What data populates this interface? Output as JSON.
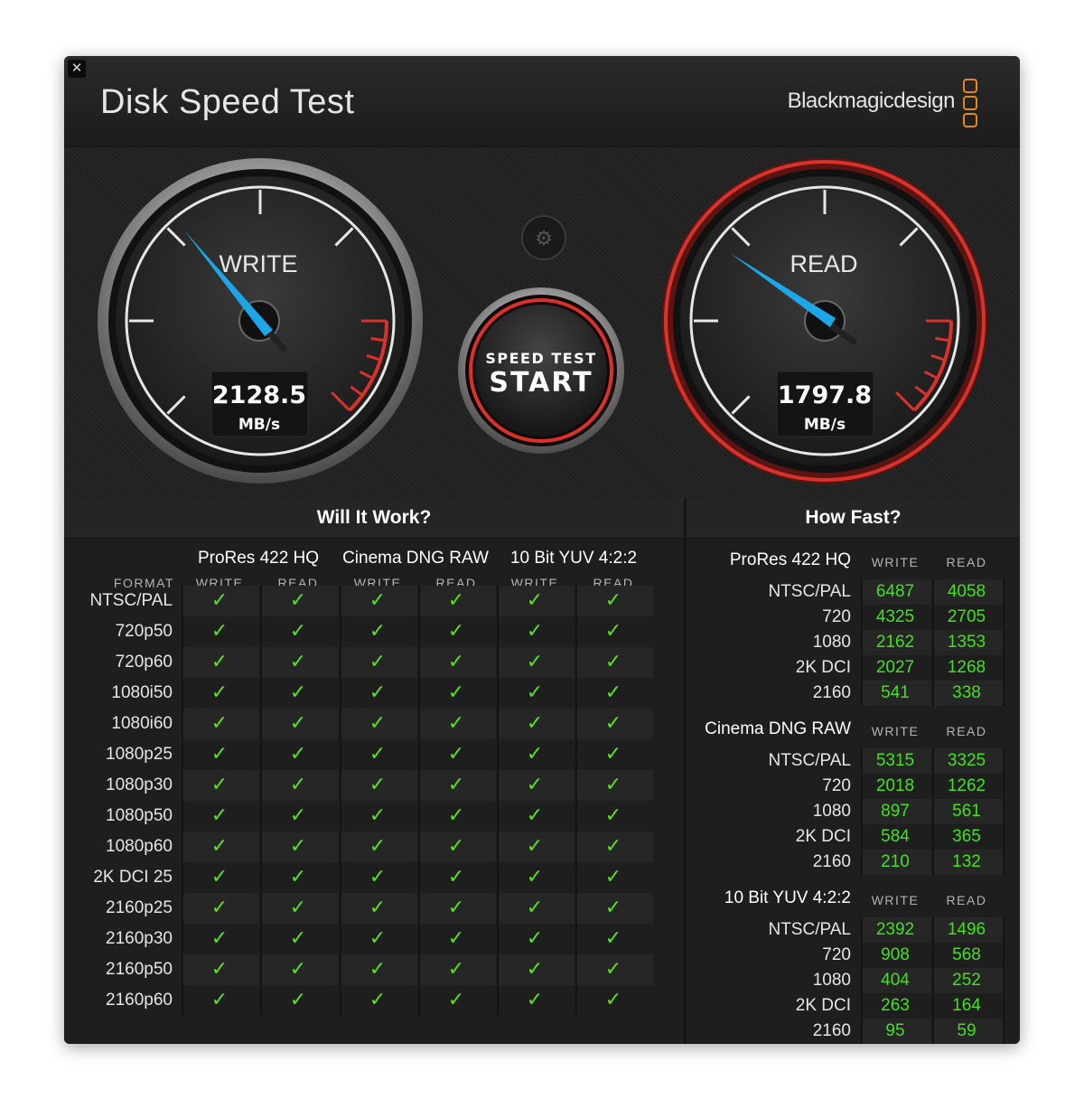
{
  "window": {
    "close_label": "✕",
    "title": "Disk Speed Test",
    "brand": "Blackmagicdesign"
  },
  "gauges": {
    "write": {
      "label": "WRITE",
      "value": "2128.5",
      "unit": "MB/s"
    },
    "read": {
      "label": "READ",
      "value": "1797.8",
      "unit": "MB/s"
    },
    "start_button": {
      "line1": "SPEED TEST",
      "line2": "START"
    },
    "settings_icon": "gear-icon"
  },
  "will_it_work": {
    "title": "Will It Work?",
    "format_header": "FORMAT",
    "groups": [
      "ProRes 422 HQ",
      "Cinema DNG RAW",
      "10 Bit YUV 4:2:2"
    ],
    "col_write": "WRITE",
    "col_read": "READ",
    "check_glyph": "✓",
    "formats": [
      "NTSC/PAL",
      "720p50",
      "720p60",
      "1080i50",
      "1080i60",
      "1080p25",
      "1080p30",
      "1080p50",
      "1080p60",
      "2K DCI 25",
      "2160p25",
      "2160p30",
      "2160p50",
      "2160p60"
    ]
  },
  "how_fast": {
    "title": "How Fast?",
    "col_write": "WRITE",
    "col_read": "READ",
    "groups": [
      {
        "name": "ProRes 422 HQ",
        "rows": [
          {
            "format": "NTSC/PAL",
            "write": "6487",
            "read": "4058"
          },
          {
            "format": "720",
            "write": "4325",
            "read": "2705"
          },
          {
            "format": "1080",
            "write": "2162",
            "read": "1353"
          },
          {
            "format": "2K DCI",
            "write": "2027",
            "read": "1268"
          },
          {
            "format": "2160",
            "write": "541",
            "read": "338"
          }
        ]
      },
      {
        "name": "Cinema DNG RAW",
        "rows": [
          {
            "format": "NTSC/PAL",
            "write": "5315",
            "read": "3325"
          },
          {
            "format": "720",
            "write": "2018",
            "read": "1262"
          },
          {
            "format": "1080",
            "write": "897",
            "read": "561"
          },
          {
            "format": "2K DCI",
            "write": "584",
            "read": "365"
          },
          {
            "format": "2160",
            "write": "210",
            "read": "132"
          }
        ]
      },
      {
        "name": "10 Bit YUV 4:2:2",
        "rows": [
          {
            "format": "NTSC/PAL",
            "write": "2392",
            "read": "1496"
          },
          {
            "format": "720",
            "write": "908",
            "read": "568"
          },
          {
            "format": "1080",
            "write": "404",
            "read": "252"
          },
          {
            "format": "2K DCI",
            "write": "263",
            "read": "164"
          },
          {
            "format": "2160",
            "write": "95",
            "read": "59"
          }
        ]
      }
    ]
  },
  "colors": {
    "accent_blue": "#1ea7e8",
    "gauge_red": "#d8322b",
    "value_green": "#44e01c",
    "logo_orange": "#e08a1e"
  }
}
